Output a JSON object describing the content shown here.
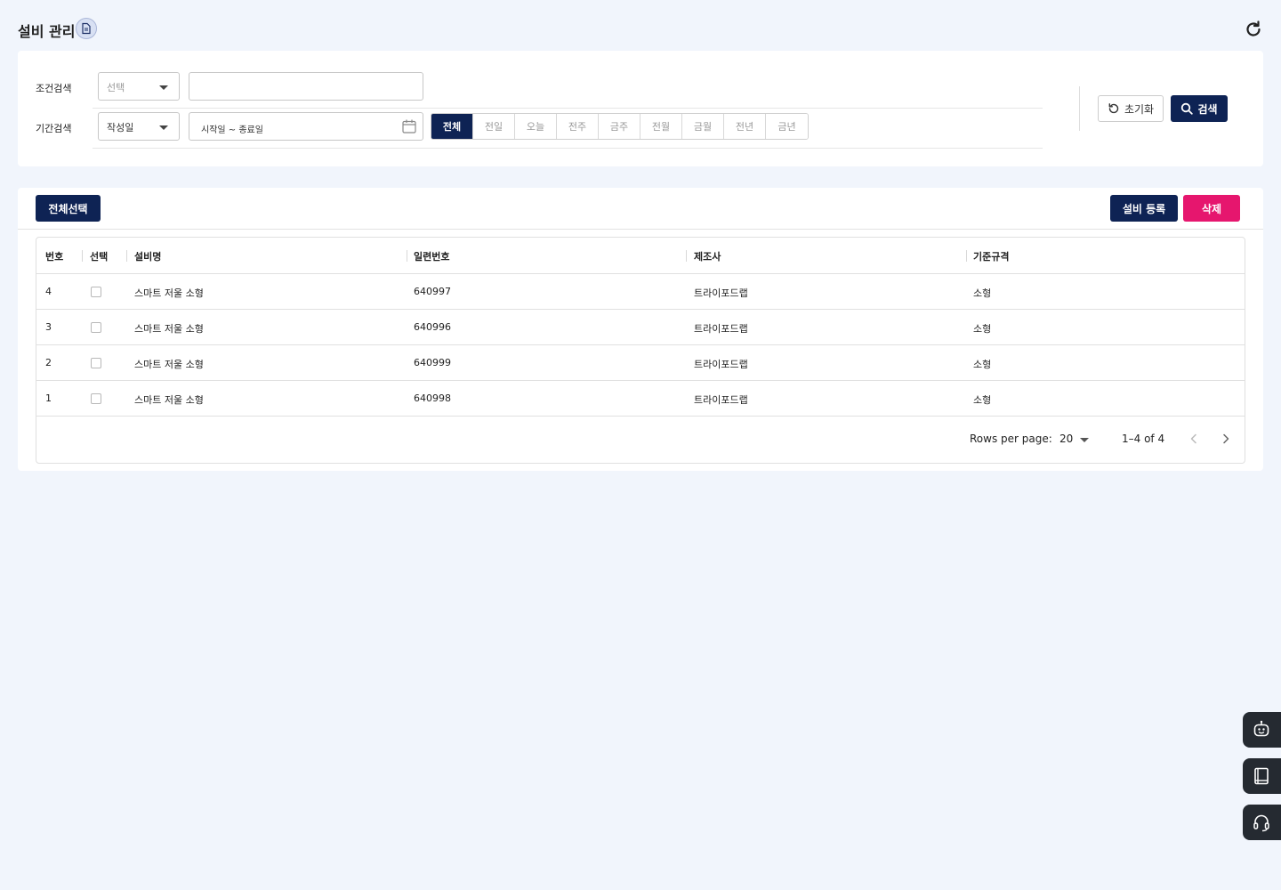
{
  "header": {
    "title": "설비 관리",
    "title_icon": "document-icon",
    "refresh_icon": "refresh-icon"
  },
  "search": {
    "condition_label": "조건검색",
    "condition_select": "선택",
    "condition_input_value": "",
    "period_label": "기간검색",
    "period_select": "작성일",
    "date_range_placeholder": "시작일 ~ 종료일",
    "period_buttons": [
      "전체",
      "전일",
      "오늘",
      "전주",
      "금주",
      "전월",
      "금월",
      "전년",
      "금년"
    ],
    "period_active_index": 0,
    "reset_label": "초기화",
    "search_label": "검색"
  },
  "toolbar": {
    "select_all_label": "전체선택",
    "register_label": "설비 등록",
    "delete_label": "삭제"
  },
  "table": {
    "columns": [
      "번호",
      "선택",
      "설비명",
      "일련번호",
      "제조사",
      "기준규격"
    ],
    "rows": [
      {
        "no": "4",
        "checked": false,
        "name": "스마트 저울 소형",
        "serial": "640997",
        "maker": "트라이포드랩",
        "spec": "소형"
      },
      {
        "no": "3",
        "checked": false,
        "name": "스마트 저울 소형",
        "serial": "640996",
        "maker": "트라이포드랩",
        "spec": "소형"
      },
      {
        "no": "2",
        "checked": false,
        "name": "스마트 저울 소형",
        "serial": "640999",
        "maker": "트라이포드랩",
        "spec": "소형"
      },
      {
        "no": "1",
        "checked": false,
        "name": "스마트 저울 소형",
        "serial": "640998",
        "maker": "트라이포드랩",
        "spec": "소형"
      }
    ]
  },
  "pagination": {
    "rows_per_page_label": "Rows per page:",
    "rows_per_page_value": "20",
    "range_text": "1–4 of 4"
  },
  "floating_buttons": [
    "chatbot-icon",
    "manual-book-icon",
    "headset-support-icon"
  ],
  "colors": {
    "primary_navy": "#0e2354",
    "delete_pink": "#e6166e",
    "page_bg": "#f1f5fc",
    "fab_bg": "#252a31"
  }
}
